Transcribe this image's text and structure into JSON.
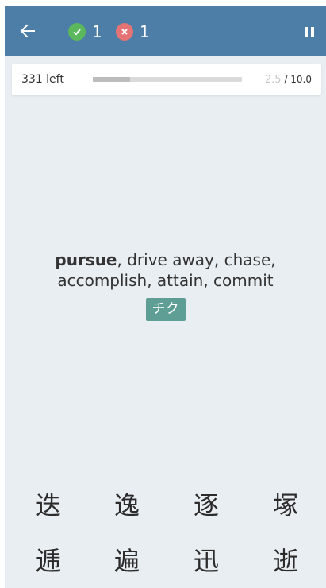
{
  "colors": {
    "header": "#4d7ea8",
    "background": "#e9eef2",
    "correct": "#5cb85c",
    "wrong": "#e57373",
    "reading_badge": "#5e9e94"
  },
  "header": {
    "back_icon": "arrow-left-icon",
    "correct_icon": "check-circle-icon",
    "correct_count": "1",
    "wrong_icon": "x-circle-icon",
    "wrong_count": "1",
    "pause_icon": "pause-icon"
  },
  "progress": {
    "remaining_label": "331 left",
    "timer_value": "2.5",
    "timer_max": "/ 10.0",
    "fraction": 0.25
  },
  "prompt": {
    "keyword": "pursue",
    "meanings_line1_rest": ", drive away, chase,",
    "meanings_line2": "accomplish, attain, commit",
    "reading": "チク"
  },
  "choices": [
    "迭",
    "逸",
    "逐",
    "塚",
    "逓",
    "遍",
    "迅",
    "逝"
  ]
}
